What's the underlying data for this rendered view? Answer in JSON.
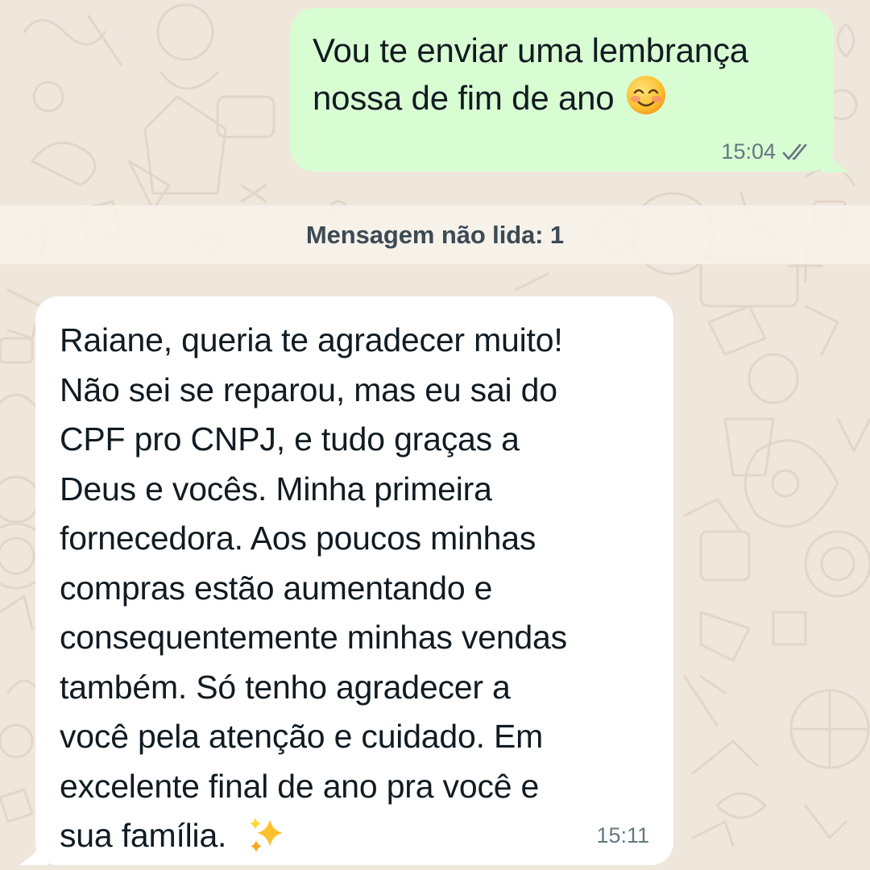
{
  "messages": {
    "outgoing": {
      "line1": "Vou te enviar uma lembrança",
      "line2": "nossa de fim de ano",
      "emoji": "smiling-face-with-smiling-eyes",
      "time": "15:04",
      "status": "read"
    },
    "unread_banner": "Mensagem não lida: 1",
    "incoming": {
      "text": "Raiane, queria te agradecer muito!\nNão sei se reparou, mas eu sai do\nCPF pro CNPJ, e tudo graças a\nDeus  e vocês. Minha primeira\nfornecedora. Aos poucos minhas\ncompras estão aumentando e\nconsequentemente minhas vendas\ntambém. Só tenho agradecer a\nvocê pela atenção e cuidado. Em\nexcelente final de ano pra você e\nsua família.",
      "emoji": "sparkles",
      "time": "15:11"
    }
  },
  "colors": {
    "background": "#efe7dc",
    "outgoing_bubble": "#d9fdd3",
    "incoming_bubble": "#ffffff",
    "text": "#111b21",
    "meta": "#667781",
    "banner_text": "#3b4a54"
  }
}
